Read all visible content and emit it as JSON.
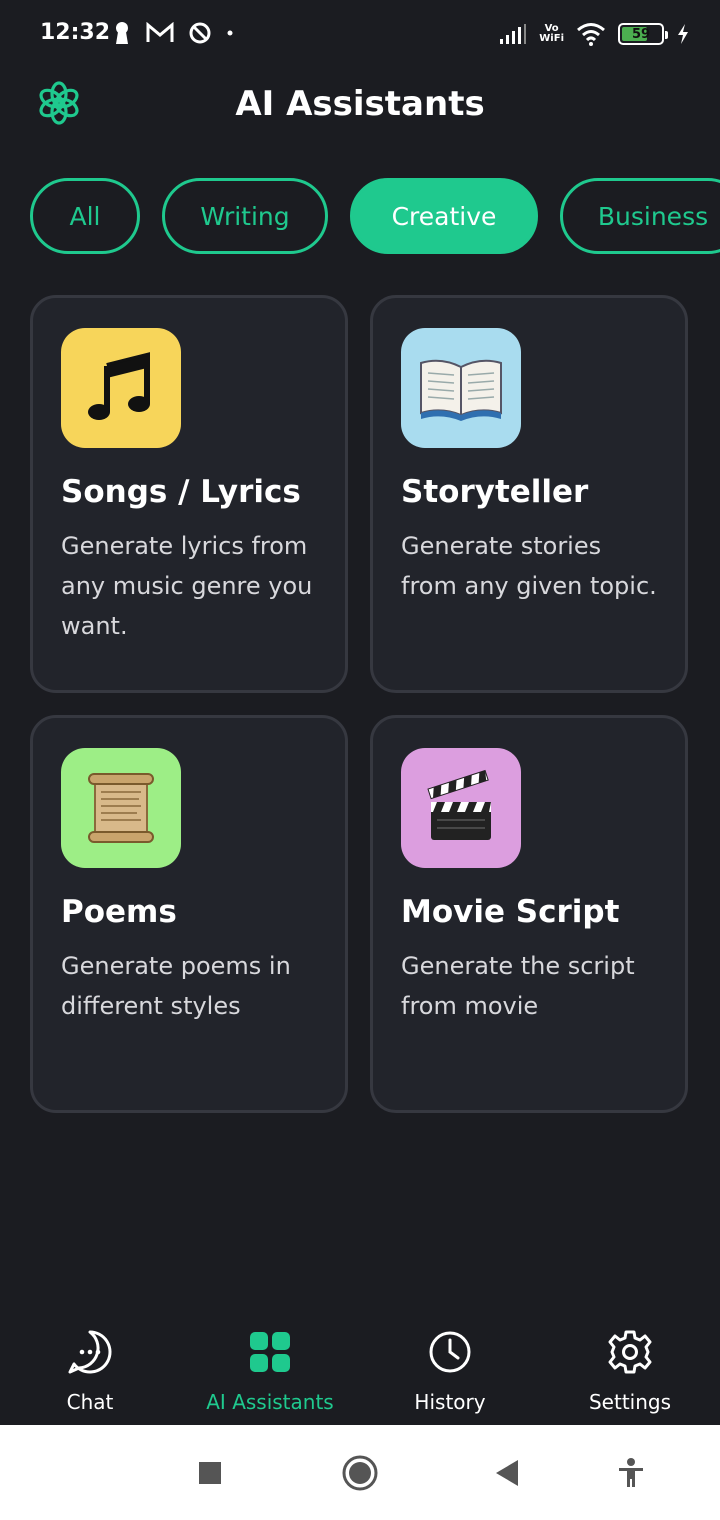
{
  "status_bar": {
    "time": "12:32",
    "network_label": "Vo\nWiFi",
    "battery_level": "59",
    "battery_percent": 59
  },
  "header": {
    "title": "AI Assistants",
    "logo_icon": "openai-logo-icon"
  },
  "categories": [
    {
      "label": "All",
      "active": false
    },
    {
      "label": "Writing",
      "active": false
    },
    {
      "label": "Creative",
      "active": true
    },
    {
      "label": "Business",
      "active": false
    }
  ],
  "cards": [
    {
      "title": "Songs / Lyrics",
      "description": "Generate lyrics from any music genre you want.",
      "icon": "music-notes-icon",
      "icon_bg": "#f7d55a"
    },
    {
      "title": "Storyteller",
      "description": "Generate stories from any given topic.",
      "icon": "open-book-icon",
      "icon_bg": "#a9dcef"
    },
    {
      "title": "Poems",
      "description": "Generate poems in different styles",
      "icon": "scroll-icon",
      "icon_bg": "#9dee86"
    },
    {
      "title": "Movie Script",
      "description": "Generate the script from movie",
      "icon": "clapperboard-icon",
      "icon_bg": "#dc9edf"
    }
  ],
  "bottom_nav": [
    {
      "label": "Chat",
      "icon": "chat-bubble-icon",
      "active": false
    },
    {
      "label": "AI Assistants",
      "icon": "grid-icon",
      "active": true
    },
    {
      "label": "History",
      "icon": "clock-icon",
      "active": false
    },
    {
      "label": "Settings",
      "icon": "gear-icon",
      "active": false
    }
  ],
  "colors": {
    "accent": "#1fc98e",
    "background": "#1b1c21",
    "card": "#22242b"
  }
}
